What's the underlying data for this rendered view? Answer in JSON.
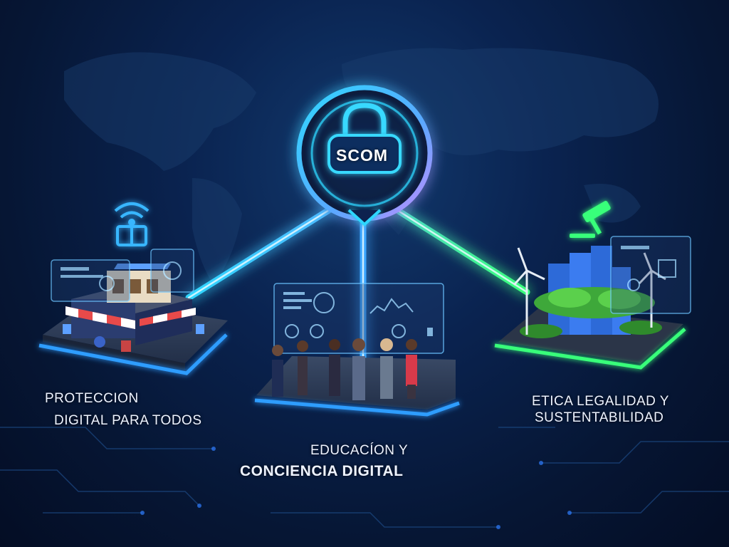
{
  "emblem": {
    "text": "SCOM"
  },
  "pillars": [
    {
      "line1": "PROTECCION",
      "line2": "DIGITAL PARA TODOS"
    },
    {
      "line1": "EDUCACÍON Y",
      "line2": "CONCIENCIA DIGITAL"
    },
    {
      "line1": "ETICA  LEGALIDAD Y",
      "line2": "SUSTENTABILIDAD"
    }
  ],
  "colors": {
    "background": "#061634",
    "cyan_glow": "#2fd6ff",
    "blue_glow": "#2f7dff",
    "green_glow": "#39ff7a",
    "violet_glow": "#b88cff"
  }
}
